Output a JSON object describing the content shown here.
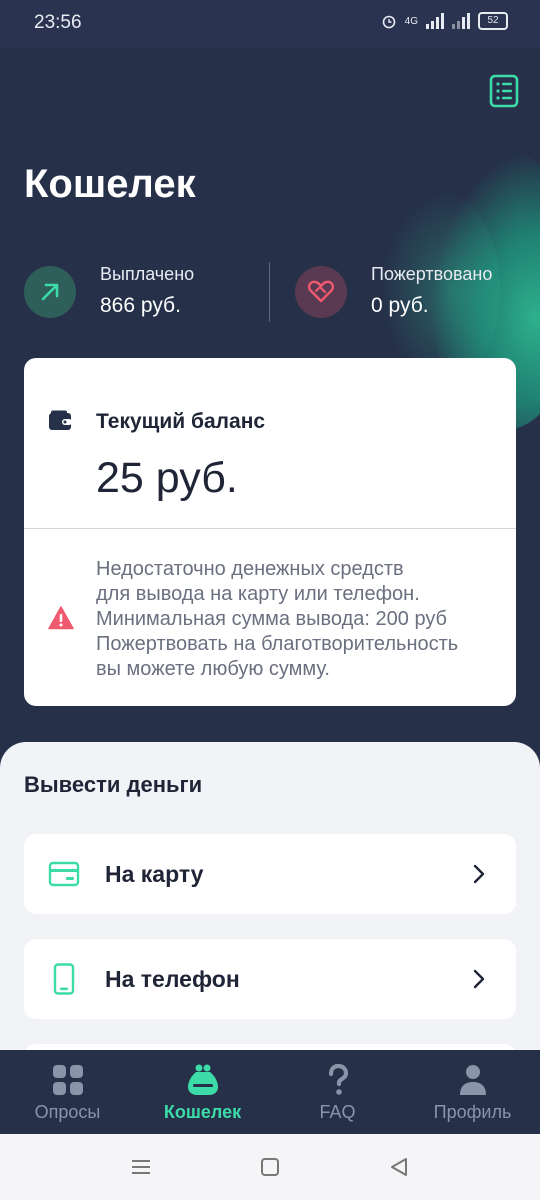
{
  "status_bar": {
    "time": "23:56",
    "battery": "52",
    "network": "4G"
  },
  "header": {
    "title": "Кошелек"
  },
  "stats": [
    {
      "label": "Выплачено",
      "value": "866 руб.",
      "icon": "arrow-up-right-icon",
      "color": "#3ddba8"
    },
    {
      "label": "Пожертвовано",
      "value": "0 руб.",
      "icon": "heart-handshake-icon",
      "color": "#ef5a6f"
    }
  ],
  "balance": {
    "label": "Текущий баланс",
    "value": "25 руб.",
    "warning_lines": [
      "Недостаточно денежных средств",
      "для вывода на карту или телефон.",
      "Минимальная сумма вывода: 200 руб",
      "Пожертвовать на благотворительность",
      "вы можете любую сумму."
    ]
  },
  "withdraw": {
    "title": "Вывести деньги",
    "options": [
      {
        "label": "На карту",
        "icon": "card-icon"
      },
      {
        "label": "На телефон",
        "icon": "phone-icon"
      }
    ]
  },
  "tabs": [
    {
      "label": "Опросы",
      "icon": "grid-icon",
      "active": false
    },
    {
      "label": "Кошелек",
      "icon": "wallet-icon",
      "active": true
    },
    {
      "label": "FAQ",
      "icon": "question-icon",
      "active": false
    },
    {
      "label": "Профиль",
      "icon": "person-icon",
      "active": false
    }
  ],
  "colors": {
    "accent": "#3ddba8",
    "background": "#263049",
    "danger": "#ef5a6f",
    "text_dark": "#1f2536"
  }
}
